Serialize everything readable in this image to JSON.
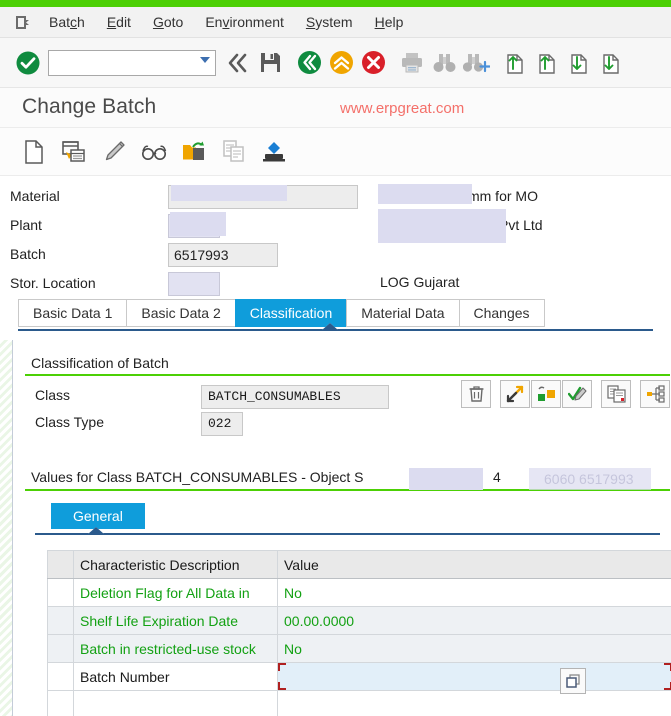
{
  "window": {
    "title": "Change Batch",
    "watermark": "www.erpgreat.com",
    "accent_green": "#4cd005",
    "accent_blue": "#0f9ddb",
    "green_text": "#13a113",
    "watermark_color": "#f4706a"
  },
  "menubar": {
    "system_icon": "sap-system-menu-icon",
    "items": [
      {
        "pre": "Bat",
        "accel": "c",
        "post": "h"
      },
      {
        "pre": "",
        "accel": "E",
        "post": "dit"
      },
      {
        "pre": "",
        "accel": "G",
        "post": "oto"
      },
      {
        "pre": "En",
        "accel": "v",
        "post": "ironment"
      },
      {
        "pre": "",
        "accel": "S",
        "post": "ystem"
      },
      {
        "pre": "",
        "accel": "H",
        "post": "elp"
      }
    ]
  },
  "toolbar": {
    "command_field_value": "",
    "command_field_placeholder": "",
    "buttons": [
      "enter-check-icon",
      "back-double-arrow-icon",
      "save-disk-icon",
      "back-green-icon",
      "exit-yellow-up-icon",
      "cancel-red-x-icon",
      "print-icon",
      "find-binoculars-icon",
      "find-next-binoculars-icon",
      "first-page-icon",
      "previous-page-icon",
      "next-page-icon",
      "last-page-icon"
    ]
  },
  "apptoolbar": {
    "buttons": [
      "new-document-icon",
      "display-layout-icon",
      "edit-pencil-icon",
      "display-glasses-icon",
      "folder-refresh-icon",
      "copy-document-icon",
      "stamp-diamond-icon"
    ]
  },
  "header_form": {
    "rows": [
      {
        "label": "Material",
        "value": "",
        "redacted": true,
        "text": "685x622x1.95mm for MO",
        "text_redacted": true
      },
      {
        "label": "Plant",
        "value": "",
        "redacted": true,
        "text": "Pvt Ltd",
        "text_redacted": true
      },
      {
        "label": "Batch",
        "value": "6517993",
        "redacted": false,
        "text": "",
        "text_redacted": false
      },
      {
        "label": "Stor. Location",
        "value": "",
        "redacted": true,
        "text": "LOG Gujarat",
        "text_redacted": false
      }
    ]
  },
  "tabs": {
    "items": [
      {
        "label": "Basic Data 1",
        "active": false
      },
      {
        "label": "Basic Data 2",
        "active": false
      },
      {
        "label": "Classification",
        "active": true
      },
      {
        "label": "Material Data",
        "active": false
      },
      {
        "label": "Changes",
        "active": false
      }
    ]
  },
  "classification": {
    "group_title": "Classification of Batch",
    "class_label": "Class",
    "class_value": "BATCH_CONSUMABLES",
    "class_type_label": "Class Type",
    "class_type_value": "022",
    "icons": [
      "delete-trash-icon",
      "assign-arrows-icon",
      "allocate-folder-icon",
      "check-entries-icon",
      "copy-values-icon",
      "class-hierarchy-icon"
    ]
  },
  "values": {
    "title": "Values for Class BATCH_CONSUMABLES - Object S",
    "object_number": "4",
    "object_faded": "6060 6517993",
    "subtab_label": "General"
  },
  "table": {
    "columns": [
      "",
      "Characteristic Description",
      "Value"
    ],
    "rows": [
      {
        "desc": "Deletion Flag for All Data in",
        "value": "No",
        "active": false
      },
      {
        "desc": "Shelf Life Expiration Date",
        "value": "00.00.0000",
        "active": false
      },
      {
        "desc": "Batch in restricted-use stock",
        "value": "No",
        "active": false
      },
      {
        "desc": "Batch Number",
        "value": "",
        "active": true
      }
    ],
    "value_help_icon": "multiple-selection-icon"
  }
}
